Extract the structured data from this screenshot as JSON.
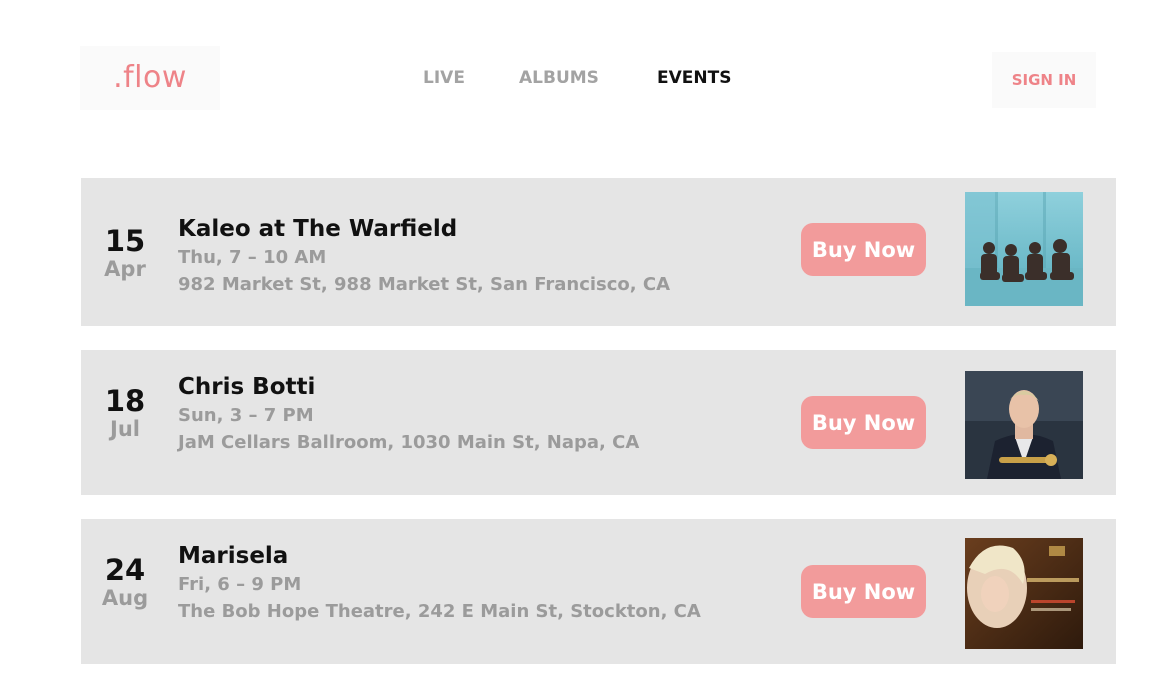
{
  "header": {
    "logo_text": ".flow",
    "nav": [
      {
        "label": "LIVE",
        "active": false
      },
      {
        "label": "ALBUMS",
        "active": false
      },
      {
        "label": "EVENTS",
        "active": true
      }
    ],
    "signin_label": "SIGN IN"
  },
  "events": [
    {
      "day": "15",
      "month": "Apr",
      "title": "Kaleo at The Warfield",
      "time": "Thu, 7 – 10 AM",
      "venue": "982 Market St, 988 Market St, San Francisco, CA",
      "buy_label": "Buy Now"
    },
    {
      "day": "18",
      "month": "Jul",
      "title": "Chris Botti",
      "time": "Sun, 3 – 7 PM",
      "venue": "JaM Cellars Ballroom, 1030 Main St, Napa, CA",
      "buy_label": "Buy Now"
    },
    {
      "day": "24",
      "month": "Aug",
      "title": "Marisela",
      "time": "Fri, 6 – 9 PM",
      "venue": "The Bob Hope Theatre, 242 E Main St, Stockton, CA",
      "buy_label": "Buy Now"
    }
  ],
  "colors": {
    "brand": "#ee8388",
    "buy_button": "#f29b9b",
    "card_bg": "#e5e5e5",
    "muted_text": "#9b9b9b"
  }
}
